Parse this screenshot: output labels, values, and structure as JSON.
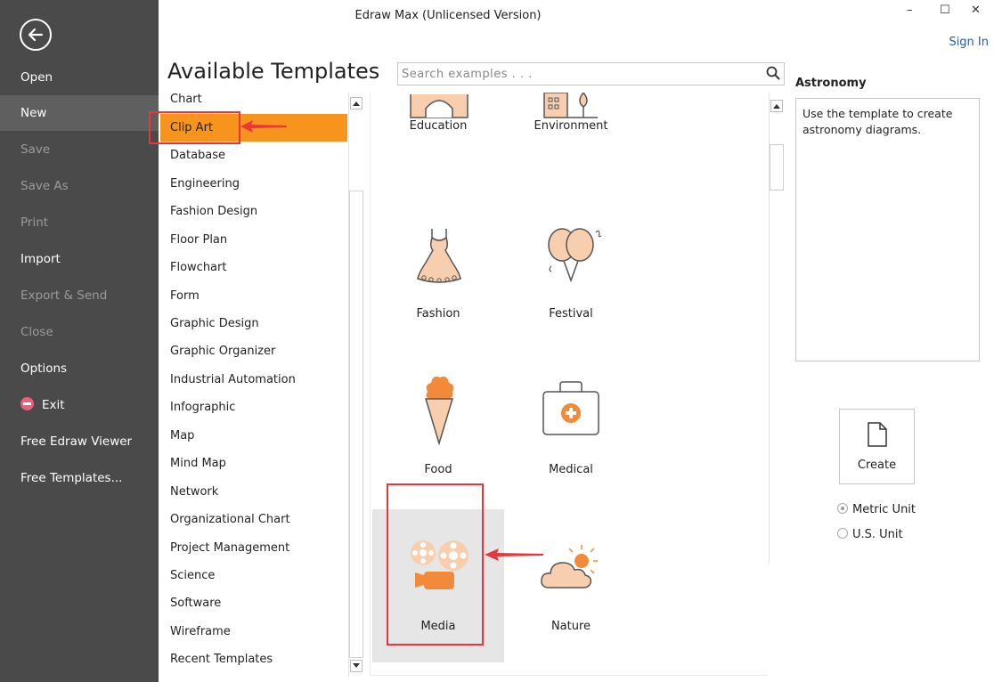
{
  "window": {
    "title": "Edraw Max (Unlicensed Version)",
    "sign_in": "Sign In",
    "minimize": "–",
    "maximize": "☐",
    "close": "✕"
  },
  "sidebar": {
    "items": [
      {
        "label": "Open",
        "state": "normal"
      },
      {
        "label": "New",
        "state": "active"
      },
      {
        "label": "Save",
        "state": "disabled"
      },
      {
        "label": "Save As",
        "state": "disabled"
      },
      {
        "label": "Print",
        "state": "disabled"
      },
      {
        "label": "Import",
        "state": "normal"
      },
      {
        "label": "Export & Send",
        "state": "disabled"
      },
      {
        "label": "Close",
        "state": "disabled"
      },
      {
        "label": "Options",
        "state": "normal"
      },
      {
        "label": "Exit",
        "state": "normal",
        "icon": "exit-icon"
      },
      {
        "label": "Free Edraw Viewer",
        "state": "normal"
      },
      {
        "label": "Free Templates...",
        "state": "normal"
      }
    ]
  },
  "main": {
    "heading": "Available Templates",
    "search_placeholder": "Search examples . . ."
  },
  "categories": [
    "Chart",
    "Clip Art",
    "Database",
    "Engineering",
    "Fashion Design",
    "Floor Plan",
    "Flowchart",
    "Form",
    "Graphic Design",
    "Graphic Organizer",
    "Industrial Automation",
    "Infographic",
    "Map",
    "Mind Map",
    "Network",
    "Organizational Chart",
    "Project Management",
    "Science",
    "Software",
    "Wireframe",
    "Recent Templates"
  ],
  "selected_category": "Clip Art",
  "templates": [
    {
      "label": "Education",
      "icon": "education-icon"
    },
    {
      "label": "Environment",
      "icon": "environment-icon"
    },
    {
      "label": "Fashion",
      "icon": "dress-icon"
    },
    {
      "label": "Festival",
      "icon": "balloons-icon"
    },
    {
      "label": "Food",
      "icon": "ice-cream-icon"
    },
    {
      "label": "Medical",
      "icon": "medical-kit-icon"
    },
    {
      "label": "Media",
      "icon": "film-camera-icon"
    },
    {
      "label": "Nature",
      "icon": "cloud-sun-icon"
    }
  ],
  "details": {
    "title": "Astronomy",
    "description": "Use the template to create astronomy diagrams.",
    "create_label": "Create",
    "units": [
      {
        "label": "Metric Unit",
        "checked": true
      },
      {
        "label": "U.S. Unit",
        "checked": false
      }
    ]
  },
  "colors": {
    "sidebar_bg": "#4a4a4a",
    "selected_accent": "#f7941d",
    "icon_peach": "#f7cfae",
    "icon_orange": "#f28a3c",
    "annotation_red": "#e8363c"
  }
}
